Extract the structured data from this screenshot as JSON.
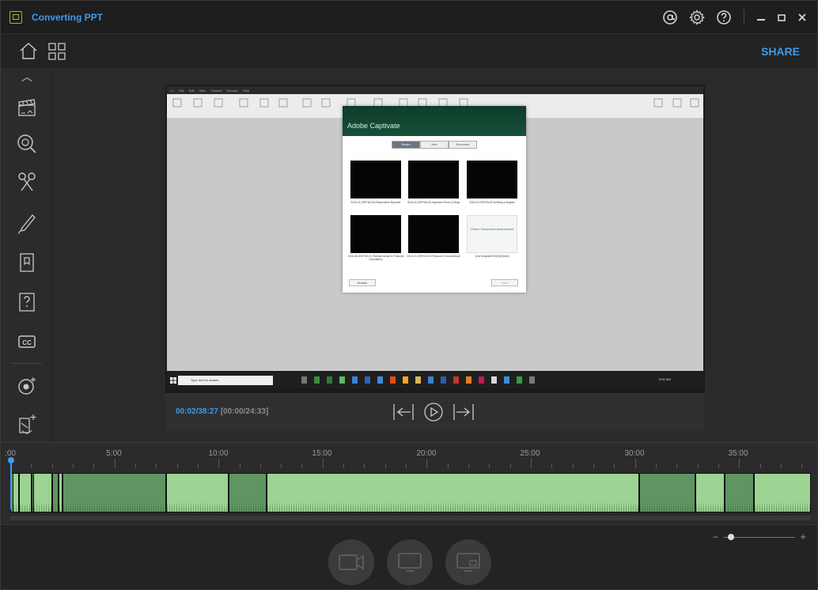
{
  "titlebar": {
    "title": "Converting PPT",
    "icons": [
      "at-icon",
      "gear-icon",
      "help-icon"
    ],
    "window_controls": [
      "minimize",
      "maximize",
      "close"
    ]
  },
  "toolbar": {
    "share_label": "SHARE",
    "icons": [
      "home-icon",
      "grid-icon"
    ]
  },
  "rail": {
    "items": [
      "clapperboard-icon",
      "zoom-pan-icon",
      "scissors-icon",
      "pen-icon",
      "bookmark-icon",
      "quiz-icon",
      "cc-icon",
      "record-overlay-icon",
      "add-slide-icon"
    ],
    "cc_label": "CC"
  },
  "preview": {
    "menu_items": [
      "Cp",
      "File",
      "Edit",
      "View",
      "Themes",
      "Window",
      "Help"
    ],
    "dialog": {
      "title": "Adobe Captivate",
      "tabs": [
        "Recent",
        "New",
        "Resources"
      ],
      "active_tab": "Recent",
      "thumbnails": [
        {
          "caption": "2016-01-DSFHW-05-Responsible-Reporter",
          "style": "dark"
        },
        {
          "caption": "2016-01-DSFHW-05-Important Terms & Regs",
          "style": "dark"
        },
        {
          "caption": "2016-04-DSFHW-05 Defining-a-Neglect",
          "style": "dark"
        },
        {
          "caption": "2016-45-DSFHW-02-Parental Abuse & Financial Exploitation",
          "style": "dark"
        },
        {
          "caption": "2016-47-DSFHW-02-Physical & Sexual Abuse",
          "style": "dark"
        },
        {
          "caption": "QuizTemplate2016(2)(Edited)",
          "style": "light",
          "thumb_title": "Online Classroom Assessment"
        }
      ],
      "browse_label": "Browse",
      "open_label": "Open"
    },
    "taskbar": {
      "search_placeholder": "Type here to search",
      "clock": "5:00 AM"
    }
  },
  "playback": {
    "current": "00:02/38:27",
    "segment": "[00:00/24:33]"
  },
  "timeline": {
    "ruler_labels": [
      ":00",
      "5:00",
      "10:00",
      "15:00",
      "20:00",
      "25:00",
      "30:00",
      "35:00"
    ],
    "clips": [
      {
        "start": 0.0,
        "end": 0.12,
        "tone": "dark"
      },
      {
        "start": 0.12,
        "end": 0.42,
        "tone": "light"
      },
      {
        "start": 0.42,
        "end": 1.02,
        "tone": "light"
      },
      {
        "start": 1.02,
        "end": 1.12,
        "tone": "dark"
      },
      {
        "start": 1.12,
        "end": 2.02,
        "tone": "light"
      },
      {
        "start": 2.02,
        "end": 2.32,
        "tone": "dark"
      },
      {
        "start": 2.32,
        "end": 2.5,
        "tone": "light"
      },
      {
        "start": 2.5,
        "end": 7.5,
        "tone": "dark"
      },
      {
        "start": 7.5,
        "end": 10.5,
        "tone": "light"
      },
      {
        "start": 10.5,
        "end": 12.3,
        "tone": "dark"
      },
      {
        "start": 12.3,
        "end": 30.2,
        "tone": "light"
      },
      {
        "start": 30.2,
        "end": 32.9,
        "tone": "dark"
      },
      {
        "start": 32.9,
        "end": 34.3,
        "tone": "light"
      },
      {
        "start": 34.3,
        "end": 35.7,
        "tone": "dark"
      },
      {
        "start": 35.7,
        "end": 38.45,
        "tone": "light"
      }
    ],
    "total_minutes": 38.45,
    "playhead_minutes": 0.03
  },
  "record_buttons": [
    "camera-record-icon",
    "screen-record-icon",
    "screen-camera-record-icon"
  ],
  "zoom": {
    "minus": "−",
    "plus": "+",
    "level": 0.1
  },
  "colors": {
    "accent": "#3b9cf0",
    "clip_light": "#9dd393",
    "clip_dark": "#5f9562"
  }
}
